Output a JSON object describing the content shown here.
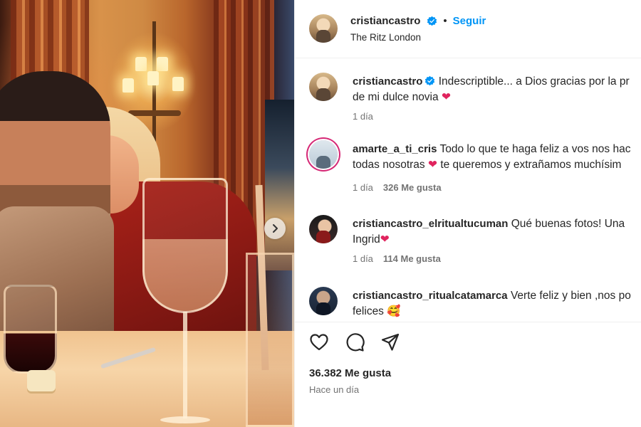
{
  "post": {
    "username": "cristiancastro",
    "follow_label": "Seguir",
    "dot": "•",
    "location": "The Ritz London",
    "carousel_next_icon": "chevron-right-icon"
  },
  "comments": [
    {
      "username": "cristiancastro",
      "verified": true,
      "line1": "Indescriptible... a Dios gracias por la pr",
      "line2": "de mi dulce novia",
      "emoji": "❤",
      "time": "1 día",
      "likes": ""
    },
    {
      "username": "amarte_a_ti_cris",
      "line1": "Todo lo que te haga feliz a vos nos hac",
      "line2": "todas nosotras",
      "line2_emoji": "❤",
      "line2_after": "te queremos y extrañamos muchísim",
      "time": "1 día",
      "likes": "326 Me gusta"
    },
    {
      "username": "cristiancastro_elritualtucuman",
      "line1": "Qué buenas fotos! Una",
      "line2": "Ingrid",
      "emoji": "❤",
      "time": "1 día",
      "likes": "114 Me gusta"
    },
    {
      "username": "cristiancastro_ritualcatamarca",
      "line1": "Verte feliz y bien ,nos po",
      "line2": "felices",
      "emoji": "🥰"
    }
  ],
  "actions": {
    "like_icon": "heart-icon",
    "comment_icon": "comment-icon",
    "share_icon": "send-icon",
    "likes_count": "36.382 Me gusta",
    "posted": "Hace un día"
  },
  "colors": {
    "accent_blue": "#0095f6",
    "heart_red": "#e0245e",
    "muted": "#737373",
    "text": "#262626"
  }
}
